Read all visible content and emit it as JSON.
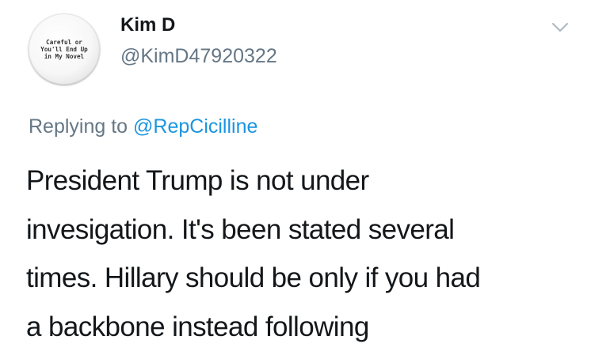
{
  "tweet": {
    "avatar_text": "Careful or\nYou'll End Up\nin My Novel",
    "display_name": "Kim D",
    "handle": "@KimD47920322",
    "menu_icon": "chevron-down-icon",
    "replying_prefix": "Replying to",
    "replying_to": "@RepCicilline",
    "text_lines": [
      "President Trump is not under",
      "invesigation. It's been stated several",
      "times. Hillary should be only if you had",
      "a backbone instead following"
    ]
  },
  "colors": {
    "text_primary": "#14171a",
    "text_secondary": "#657786",
    "link": "#1b95e0",
    "chevron": "#aab8c2",
    "background": "#ffffff"
  }
}
